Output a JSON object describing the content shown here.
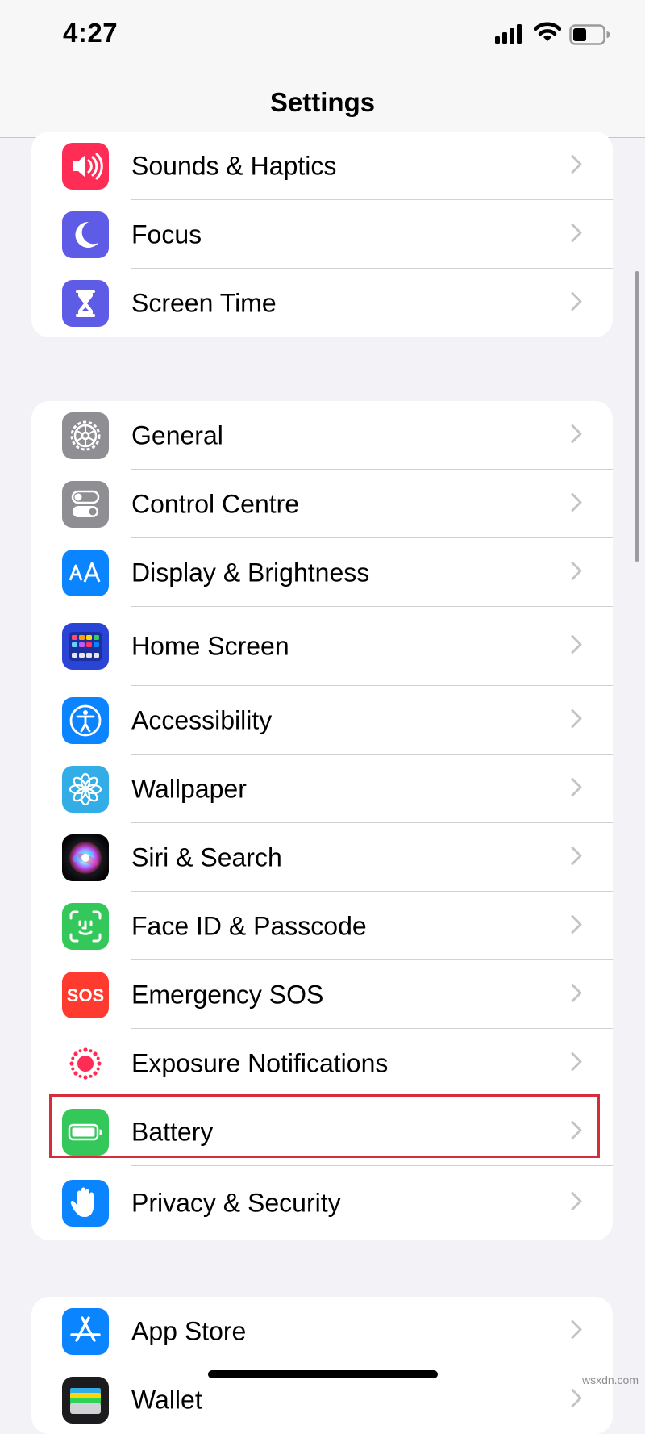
{
  "status_bar": {
    "time": "4:27",
    "battery_level": 0.45
  },
  "nav": {
    "title": "Settings"
  },
  "groups": [
    {
      "items": [
        {
          "label": "Sounds & Haptics",
          "icon": "speaker-icon",
          "color": "#ff2d55"
        },
        {
          "label": "Focus",
          "icon": "moon-icon",
          "color": "#5e5ce6"
        },
        {
          "label": "Screen Time",
          "icon": "hourglass-icon",
          "color": "#5e5ce6"
        }
      ]
    },
    {
      "items": [
        {
          "label": "General",
          "icon": "gear-icon",
          "color": "#8e8e93"
        },
        {
          "label": "Control Centre",
          "icon": "toggles-icon",
          "color": "#8e8e93"
        },
        {
          "label": "Display & Brightness",
          "icon": "text-size-icon",
          "color": "#0a84ff"
        },
        {
          "label": "Home Screen",
          "icon": "app-grid-icon",
          "color": "#2a44d6"
        },
        {
          "label": "Accessibility",
          "icon": "accessibility-icon",
          "color": "#0a84ff"
        },
        {
          "label": "Wallpaper",
          "icon": "flower-icon",
          "color": "#32ade6"
        },
        {
          "label": "Siri & Search",
          "icon": "siri-icon",
          "color": "#1c1c1e"
        },
        {
          "label": "Face ID & Passcode",
          "icon": "face-id-icon",
          "color": "#34c759"
        },
        {
          "label": "Emergency SOS",
          "icon": "sos-icon",
          "icon_text": "SOS",
          "color": "#ff3b30"
        },
        {
          "label": "Exposure Notifications",
          "icon": "exposure-icon",
          "color": "#ffffff"
        },
        {
          "label": "Battery",
          "icon": "battery-icon",
          "color": "#34c759"
        },
        {
          "label": "Privacy & Security",
          "icon": "hand-icon",
          "color": "#0a84ff"
        }
      ]
    },
    {
      "items": [
        {
          "label": "App Store",
          "icon": "app-store-icon",
          "color": "#0a84ff"
        },
        {
          "label": "Wallet",
          "icon": "wallet-icon",
          "color": "#1c1c1e"
        }
      ]
    }
  ],
  "highlight": {
    "target": "Battery",
    "color": "#d62d3a"
  },
  "watermark": "wsxdn.com"
}
